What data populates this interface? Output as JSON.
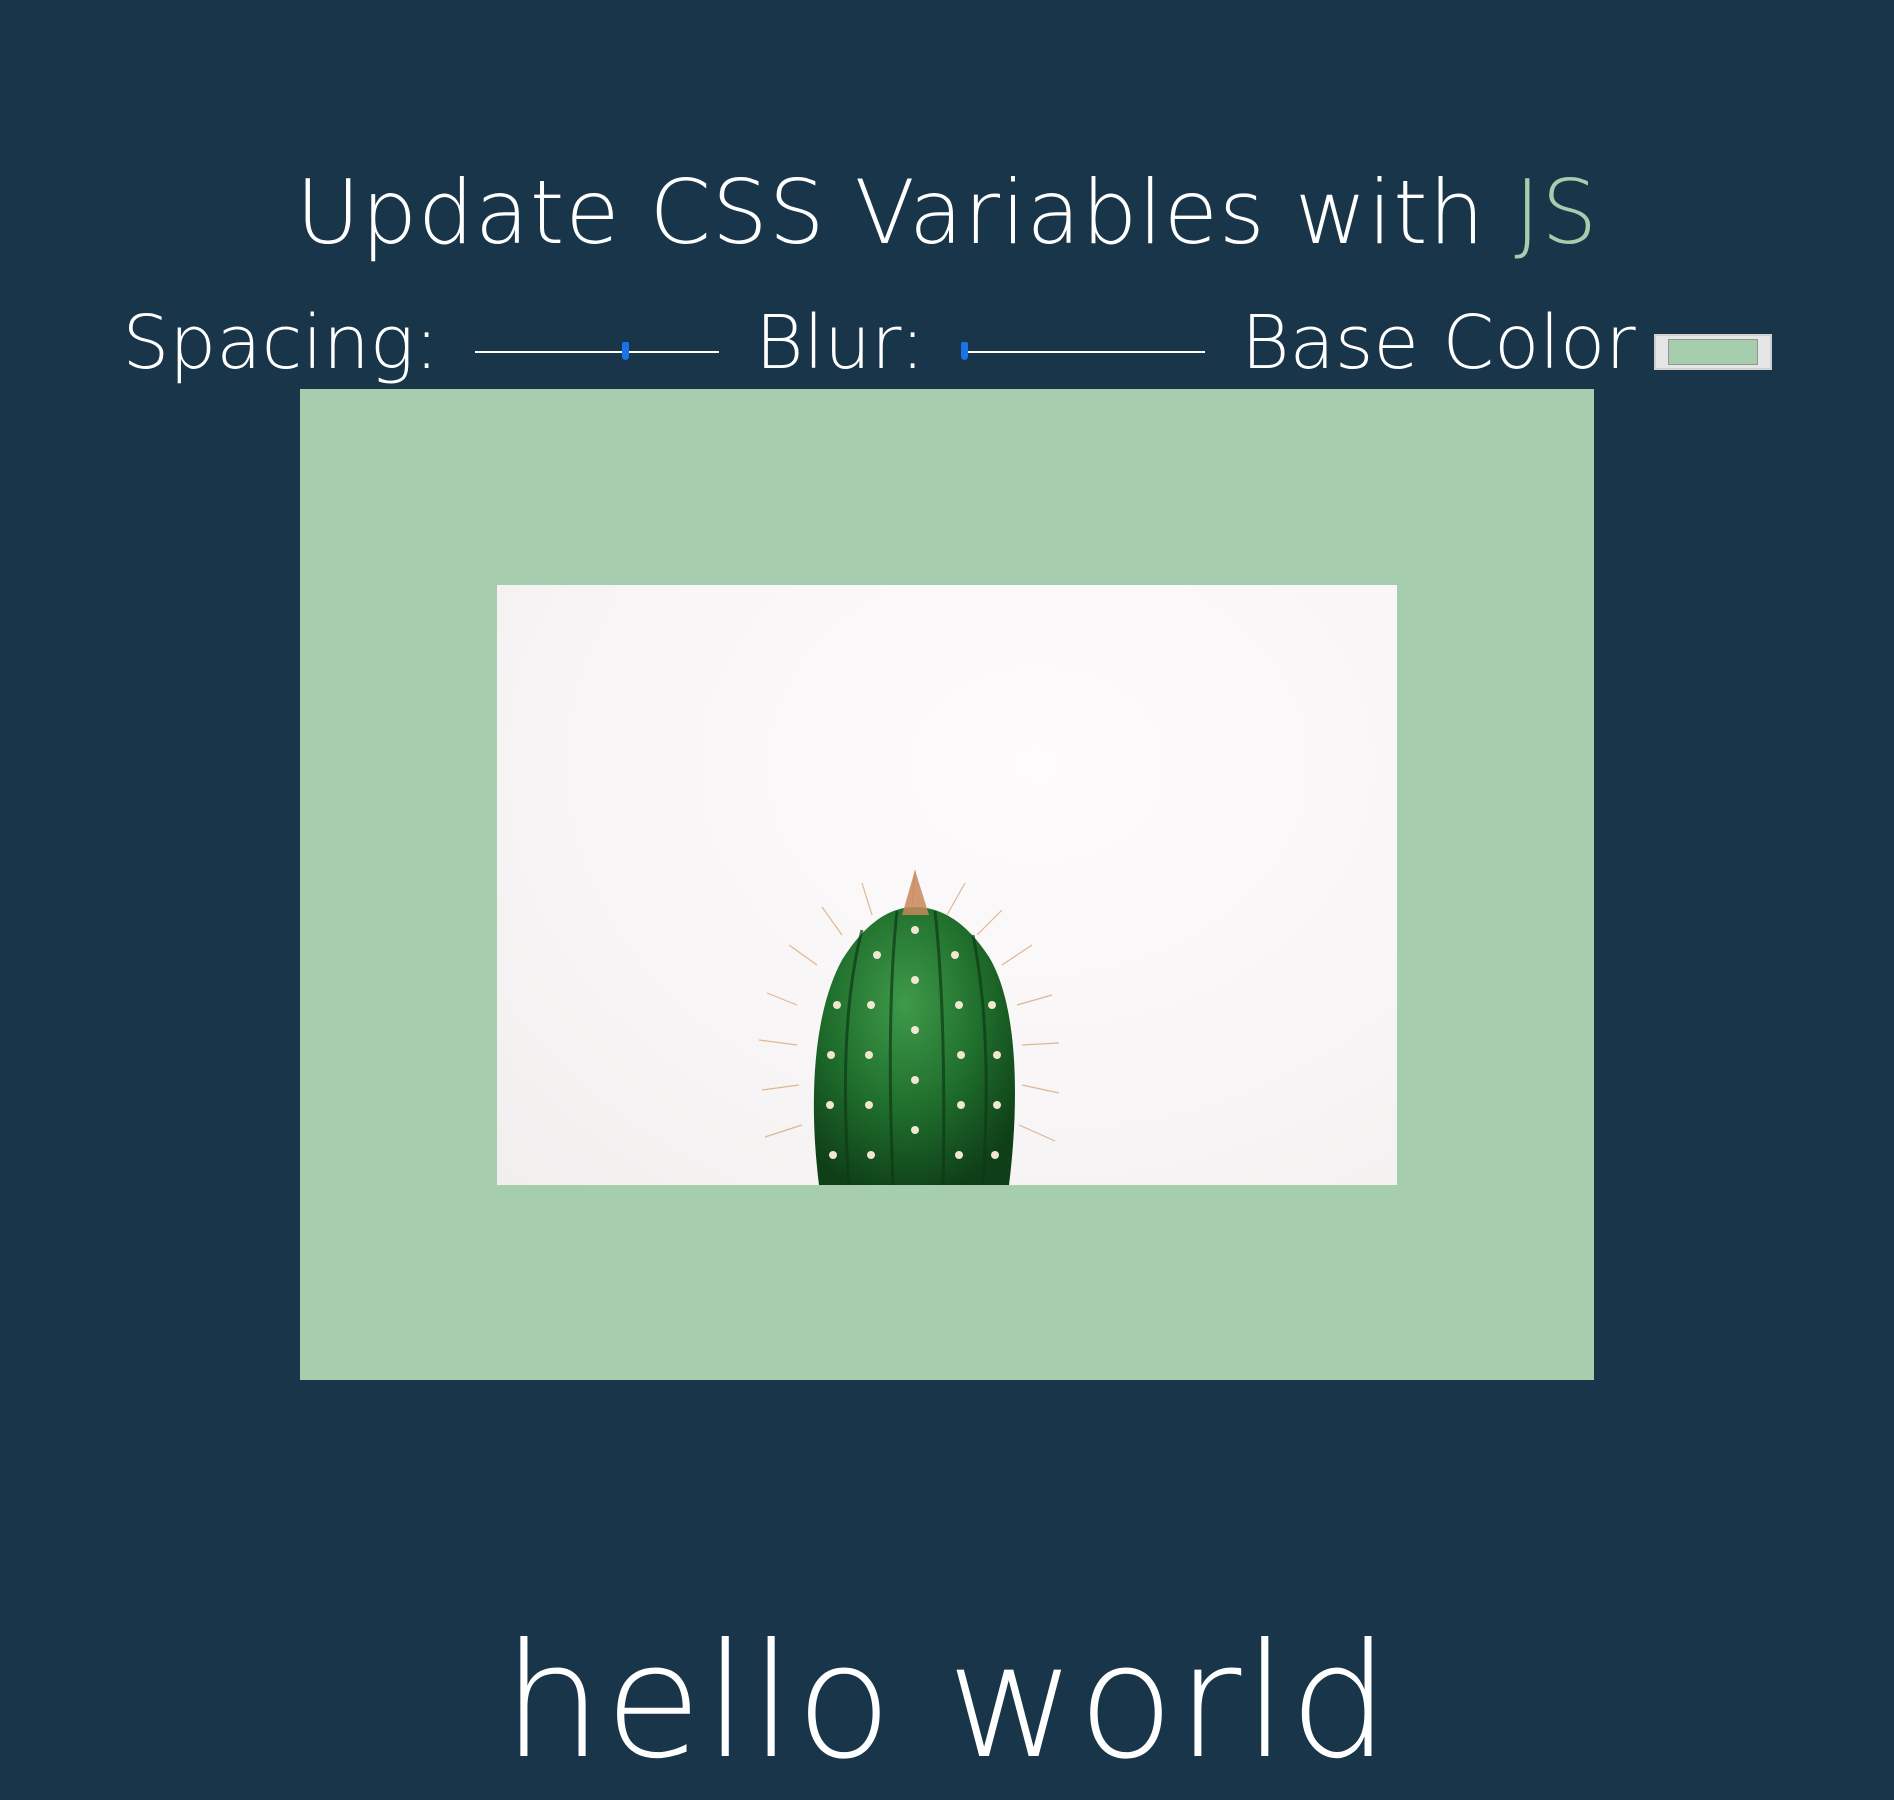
{
  "header": {
    "title_main": "Update CSS Variables with ",
    "title_highlight": "JS"
  },
  "controls": {
    "spacing": {
      "label": "Spacing:",
      "value_fraction": 0.62
    },
    "blur": {
      "label": "Blur:",
      "value_fraction": 0.0
    },
    "base_color": {
      "label": "Base Color",
      "value": "#a5cdae"
    }
  },
  "colors": {
    "background": "#193549",
    "base": "#a5cdae",
    "slider_thumb": "#1a73e8"
  },
  "image": {
    "icon": "cactus-photo"
  },
  "footer": {
    "text": "hello world"
  }
}
